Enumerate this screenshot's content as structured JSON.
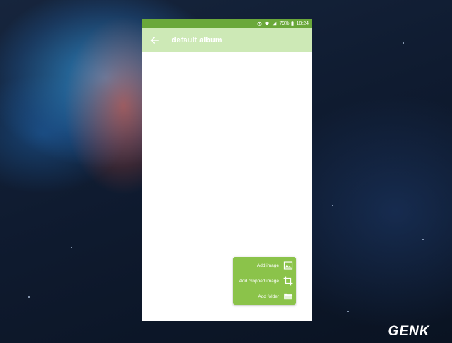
{
  "status_bar": {
    "battery": "79%",
    "time": "18:24"
  },
  "app_bar": {
    "back_icon": "arrow-left-icon",
    "title": "default album"
  },
  "fab_menu": {
    "items": [
      {
        "label": "Add image",
        "icon": "image-icon"
      },
      {
        "label": "Add cropped image",
        "icon": "crop-icon"
      },
      {
        "label": "Add folder",
        "icon": "folder-icon"
      }
    ]
  },
  "watermark": {
    "text": "GENK"
  },
  "colors": {
    "status_bar": "#6aa83a",
    "app_bar": "#cde9b6",
    "fab_background": "#8bc34a",
    "content_background": "#ffffff"
  }
}
